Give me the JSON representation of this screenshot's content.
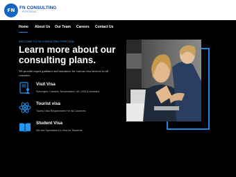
{
  "brand": {
    "logo_mark": "FN",
    "name": "FN CONSULTING",
    "subtitle": "PORTUGAL"
  },
  "nav": {
    "items": [
      {
        "label": "Home",
        "active": true
      },
      {
        "label": "About Us"
      },
      {
        "label": "Our Team"
      },
      {
        "label": "Careers"
      },
      {
        "label": "Contact Us"
      }
    ]
  },
  "hero": {
    "eyebrow": "WELCOME TO FN CONSULTING PORTUGAL",
    "headline": "Learn more about our consulting plans.",
    "intro": "We provide expert guidance and assistance for various visa services in all countries."
  },
  "services": [
    {
      "icon": "visa-document-person-icon",
      "title": "Visit Visa",
      "description": "Schengen, Canada, Newzealand, Uk, USA & Australia"
    },
    {
      "icon": "atom-icon",
      "title": "Tourist visa",
      "description": "Tourist Visa Requirement For All Countries"
    },
    {
      "icon": "open-book-icon",
      "title": "Student Visa",
      "description": "We are Specialized in Visa for Students"
    }
  ],
  "colors": {
    "accent": "#1e88e5",
    "background": "#000000",
    "header_bg": "#ffffff",
    "logo_blue": "#0d47a1"
  }
}
